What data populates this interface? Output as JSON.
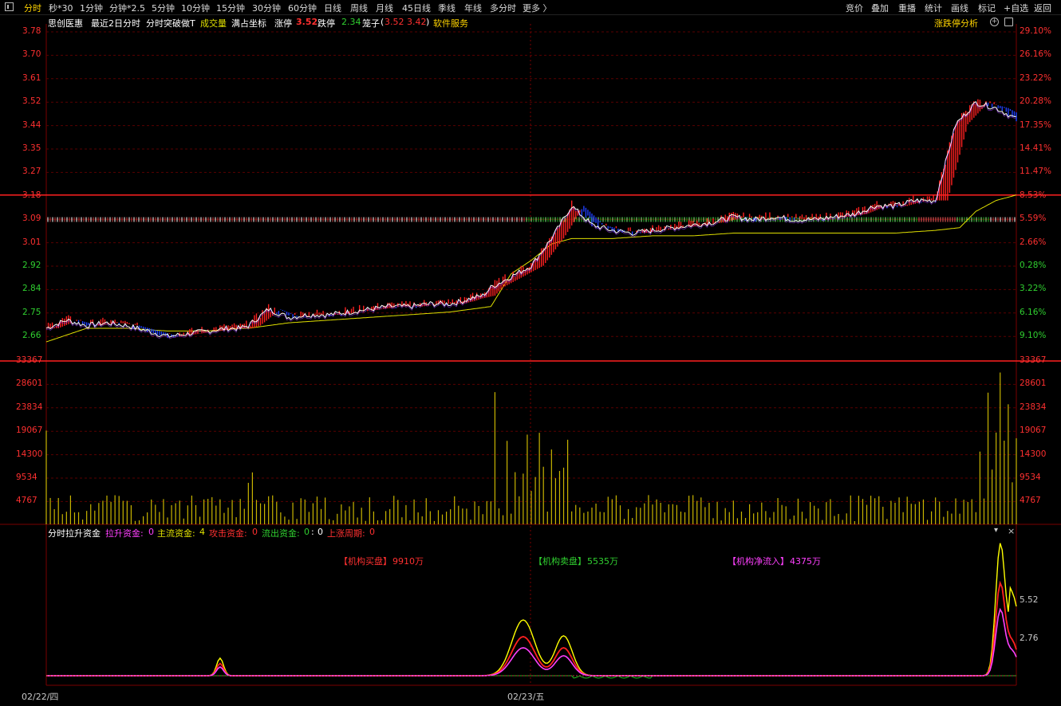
{
  "toolbar": {
    "tabs": [
      "分时",
      "秒*30",
      "1分钟",
      "分钟*2.5",
      "5分钟",
      "10分钟",
      "15分钟",
      "30分钟",
      "60分钟",
      "日线",
      "周线",
      "月线",
      "45日线",
      "季线",
      "年线",
      "多分时",
      "更多 〉"
    ],
    "active_tab": "分时",
    "right_items": [
      "竞价",
      "叠加",
      "重播",
      "统计",
      "画线",
      "标记",
      "+自选",
      "返回"
    ]
  },
  "info": {
    "stock_name": "思创医惠",
    "mode": "最近2日分时",
    "strategy": "分时突破做T",
    "volume_label": "成交量",
    "coord_label": "满占坐标",
    "limit_up_label": "涨停",
    "limit_up_value": "3.52",
    "limit_down_label": "跌停",
    "limit_down_value": "2.34",
    "fence_label": "笼子",
    "fence_open": "(",
    "fence_low": "3.52",
    "fence_high": "3.42",
    "fence_close": ")",
    "service_label": "软件服务",
    "analysis_link": "涨跌停分析"
  },
  "price_axis": {
    "left": [
      "3.78",
      "3.70",
      "3.61",
      "3.52",
      "3.44",
      "3.35",
      "3.27",
      "3.18",
      "3.09",
      "3.01",
      "2.92",
      "2.84",
      "2.75",
      "2.66"
    ],
    "right": [
      "29.10%",
      "26.16%",
      "23.22%",
      "20.28%",
      "17.35%",
      "14.41%",
      "11.47%",
      "8.53%",
      "5.59%",
      "2.66%",
      "0.28%",
      "3.22%",
      "6.16%",
      "9.10%"
    ]
  },
  "volume_axis": {
    "left": [
      "33367",
      "28601",
      "23834",
      "19067",
      "14300",
      "9534",
      "4767"
    ],
    "right": [
      "33367",
      "28601",
      "23834",
      "19067",
      "14300",
      "9534",
      "4767"
    ]
  },
  "indicator": {
    "title": "分时拉升资金",
    "items": [
      {
        "label": "拉升资金:",
        "value": "0"
      },
      {
        "label": "主流资金:",
        "value": "4"
      },
      {
        "label": "攻击资金:",
        "value": "0"
      },
      {
        "label": "流出资金:",
        "value": "0"
      },
      {
        "label": ":",
        "value": "0"
      },
      {
        "label": "上涨周期:",
        "value": "0"
      }
    ],
    "axis": [
      "5.52",
      "2.76"
    ],
    "flows": {
      "buy_label": "【机构买盘】",
      "buy_value": "9910万",
      "sell_label": "【机构卖盘】",
      "sell_value": "5535万",
      "net_label": "【机构净流入】",
      "net_value": "4375万"
    }
  },
  "dates": [
    "02/22/四",
    "02/23/五"
  ],
  "colors": {
    "up": "#ff2020",
    "down": "#20c020",
    "price_line": "#ffffff",
    "avg_line": "#e0e000",
    "volume": "#c8b400",
    "axis_red": "#ff3030",
    "axis_green": "#30d030",
    "accent_yellow": "#ffd400",
    "magenta": "#ff40ff"
  },
  "chart_data": {
    "type": "line",
    "title": "",
    "days": [
      "02/22/四",
      "02/23/五"
    ],
    "ylim": [
      2.66,
      3.78
    ],
    "reference_lines": [
      3.18,
      3.09
    ],
    "series": [
      {
        "name": "",
        "x": [
          0,
          5,
          10,
          15,
          20,
          25,
          30,
          35,
          40,
          45,
          48,
          50,
          55,
          60,
          65,
          70,
          75,
          80,
          85,
          90,
          95,
          100,
          103,
          105,
          108,
          110,
          115,
          120,
          125,
          130,
          135,
          140,
          145,
          150,
          155,
          160,
          165,
          170,
          175,
          180,
          185,
          190,
          195,
          200,
          205,
          210,
          215,
          220,
          225,
          230,
          235,
          240
        ],
        "values": [
          2.69,
          2.72,
          2.7,
          2.71,
          2.7,
          2.68,
          2.66,
          2.67,
          2.68,
          2.69,
          2.69,
          2.7,
          2.76,
          2.73,
          2.74,
          2.74,
          2.75,
          2.76,
          2.77,
          2.77,
          2.78,
          2.78,
          2.79,
          2.8,
          2.81,
          2.84,
          2.88,
          2.92,
          3.02,
          3.14,
          3.07,
          3.05,
          3.04,
          3.05,
          3.06,
          3.07,
          3.08,
          3.1,
          3.09,
          3.1,
          3.09,
          3.09,
          3.1,
          3.11,
          3.14,
          3.14,
          3.16,
          3.16,
          3.44,
          3.52,
          3.5,
          3.46
        ]
      },
      {
        "name": "",
        "x": [
          0,
          10,
          20,
          30,
          40,
          48,
          50,
          60,
          70,
          80,
          90,
          100,
          105,
          110,
          115,
          120,
          125,
          130,
          140,
          150,
          160,
          170,
          180,
          190,
          200,
          210,
          220,
          226,
          230,
          235,
          240
        ],
        "values": [
          2.64,
          2.69,
          2.69,
          2.68,
          2.68,
          2.69,
          2.69,
          2.71,
          2.72,
          2.73,
          2.74,
          2.75,
          2.76,
          2.77,
          2.89,
          2.94,
          3.0,
          3.02,
          3.02,
          3.03,
          3.03,
          3.04,
          3.04,
          3.04,
          3.04,
          3.04,
          3.05,
          3.06,
          3.12,
          3.16,
          3.18
        ]
      }
    ]
  }
}
